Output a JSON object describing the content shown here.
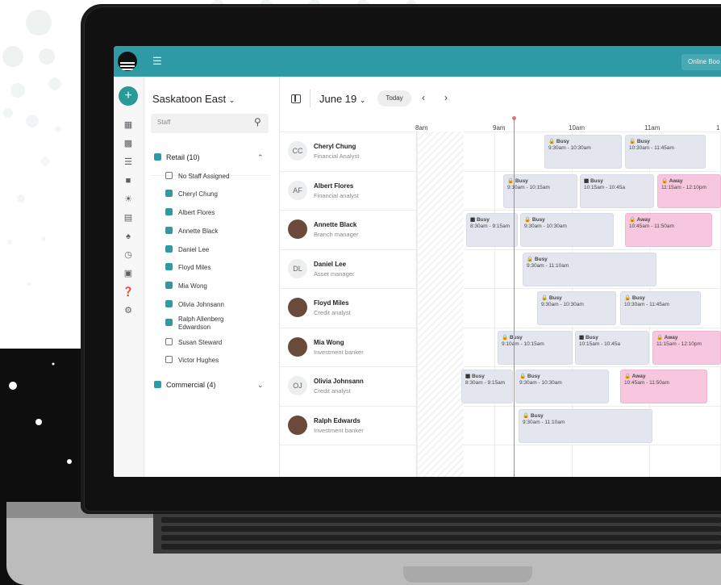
{
  "topbar": {
    "online_label": "Online Boo"
  },
  "sidebar": {
    "branch": "Saskatoon East",
    "search_placeholder": "Staff",
    "retail_group": "Retail (10)",
    "commercial_group": "Commercial (4)",
    "staff_checks": [
      {
        "label": "No Staff Assigned",
        "checked": false
      },
      {
        "label": "Cheryl Chung",
        "checked": true
      },
      {
        "label": "Albert Flores",
        "checked": true
      },
      {
        "label": "Annette Black",
        "checked": true
      },
      {
        "label": "Daniel Lee",
        "checked": true
      },
      {
        "label": "Floyd Miles",
        "checked": true
      },
      {
        "label": "Mia Wong",
        "checked": true
      },
      {
        "label": "Olivia Johnsann",
        "checked": true
      },
      {
        "label": "Ralph Allenberg",
        "checked": true
      },
      {
        "label": "Edwardson",
        "checked": true
      },
      {
        "label": "Susan Steward",
        "checked": false
      },
      {
        "label": "Victor Hughes",
        "checked": false
      }
    ]
  },
  "toolbar": {
    "date": "June 19",
    "today": "Today"
  },
  "times": [
    "8am",
    "9am",
    "10am",
    "11am",
    "1"
  ],
  "staff_rows": [
    {
      "initials": "CC",
      "name": "Cheryl Chung",
      "role": "Financial Analyst"
    },
    {
      "initials": "AF",
      "name": "Albert Flores",
      "role": "Financial analyst"
    },
    {
      "initials": "",
      "name": "Annette Black",
      "role": "Branch manager"
    },
    {
      "initials": "DL",
      "name": "Daniel Lee",
      "role": "Asset manager"
    },
    {
      "initials": "",
      "name": "Floyd Miles",
      "role": "Credit analyst"
    },
    {
      "initials": "",
      "name": "Mia Wong",
      "role": "Investment banker"
    },
    {
      "initials": "OJ",
      "name": "Olivia Johnsann",
      "role": "Credit analyst"
    },
    {
      "initials": "",
      "name": "Ralph Edwards",
      "role": "Investment banker"
    }
  ],
  "events": {
    "busy": "Busy",
    "away": "Away",
    "t1": "9:30am - 10:30am",
    "t2": "10:30am - 11:45am",
    "t3": "9:10am - 10:15am",
    "t4": "10:15am - 10:45a",
    "t5": "11:15am - 12:10pm",
    "t6": "8:30am - 9:15am",
    "t7": "10:45am - 11:50am",
    "t8": "9:30am - 11:10am"
  }
}
